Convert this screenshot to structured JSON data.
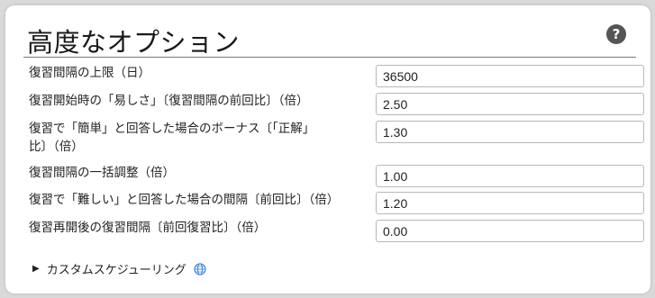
{
  "header": {
    "title": "高度なオプション",
    "help_icon": "question-circle-icon",
    "help_label": "?"
  },
  "options": [
    {
      "label": "復習間隔の上限（日）",
      "value": "36500"
    },
    {
      "label": "復習開始時の「易しさ」〔復習間隔の前回比〕（倍）",
      "value": "2.50"
    },
    {
      "label": "復習で「簡単」と回答した場合のボーナス〔「正解」比〕（倍）",
      "value": "1.30"
    },
    {
      "label": "復習間隔の一括調整（倍）",
      "value": "1.00"
    },
    {
      "label": "復習で「難しい」と回答した場合の間隔〔前回比〕（倍）",
      "value": "1.20"
    },
    {
      "label": "復習再開後の復習間隔〔前回復習比〕（倍）",
      "value": "0.00"
    }
  ],
  "custom_scheduling": {
    "label": "カスタムスケジューリング",
    "expander_icon": "triangle-right-icon",
    "globe_icon": "globe-icon"
  }
}
